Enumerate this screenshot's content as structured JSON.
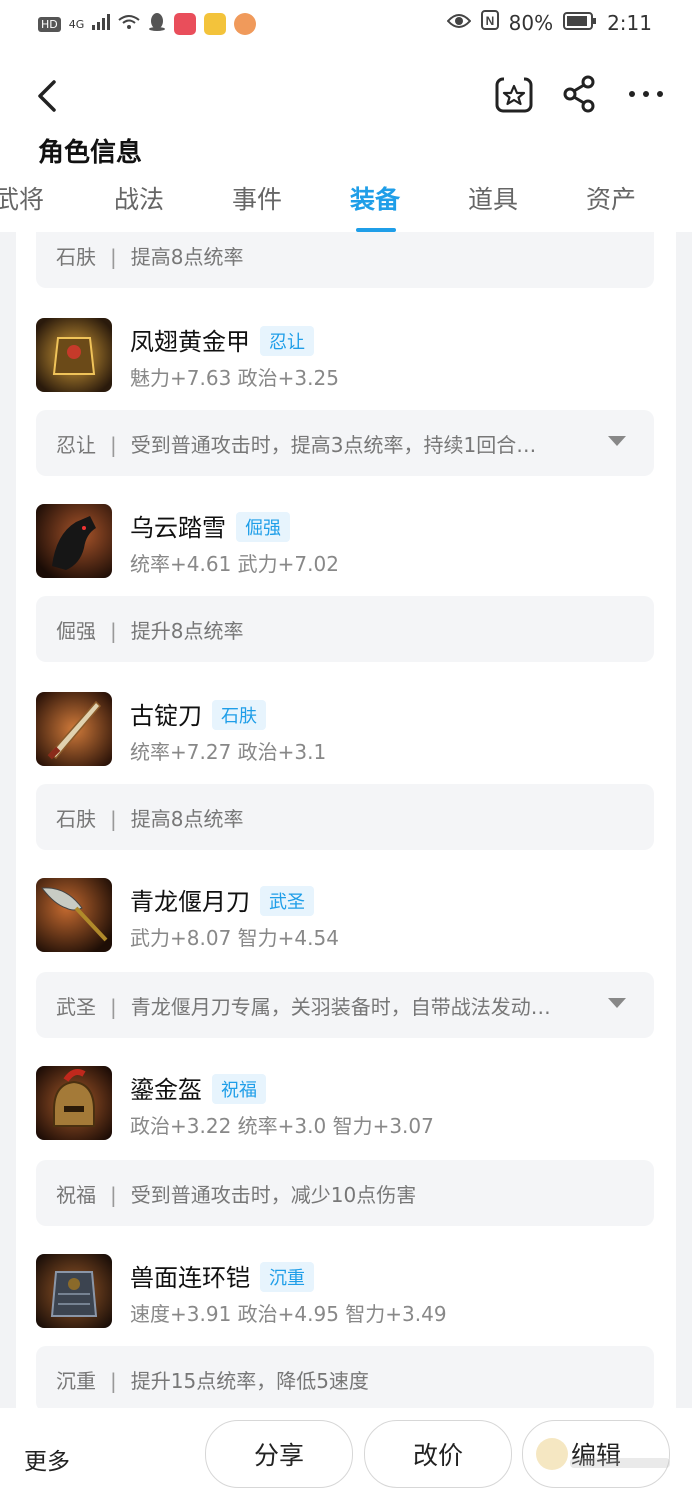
{
  "status_bar": {
    "network": "4G",
    "battery": "80%",
    "time": "2:11"
  },
  "header": {
    "title": "角色信息",
    "tabs": [
      {
        "label": "武将"
      },
      {
        "label": "战法"
      },
      {
        "label": "事件"
      },
      {
        "label": "装备",
        "active": true
      },
      {
        "label": "道具"
      },
      {
        "label": "资产"
      }
    ],
    "icons": [
      "back-icon",
      "favorite-star-icon",
      "share-icon",
      "more-icon"
    ]
  },
  "equipment": {
    "partial_top": {
      "tag": "石肤",
      "desc": "提高8点统率"
    },
    "items": [
      {
        "name": "凤翅黄金甲",
        "tag": "忍让",
        "stats": "魅力+7.63 政治+3.25",
        "desc": "受到普通攻击时，提高3点统率，持续1回合…",
        "expandable": true
      },
      {
        "name": "乌云踏雪",
        "tag": "倔强",
        "stats": "统率+4.61 武力+7.02",
        "desc": "提升8点统率",
        "expandable": false
      },
      {
        "name": "古锭刀",
        "tag": "石肤",
        "stats": "统率+7.27 政治+3.1",
        "desc": "提高8点统率",
        "expandable": false
      },
      {
        "name": "青龙偃月刀",
        "tag": "武圣",
        "stats": "武力+8.07 智力+4.54",
        "desc": "青龙偃月刀专属，关羽装备时，自带战法发动…",
        "expandable": true
      },
      {
        "name": "鎏金盔",
        "tag": "祝福",
        "stats": "政治+3.22 统率+3.0 智力+3.07",
        "desc": "受到普通攻击时，减少10点伤害",
        "expandable": false
      },
      {
        "name": "兽面连环铠",
        "tag": "沉重",
        "stats": "速度+3.91 政治+4.95 智力+3.49",
        "desc": "提升15点统率，降低5速度",
        "expandable": false
      }
    ]
  },
  "bottom_bar": {
    "more": "更多",
    "share": "分享",
    "reprice": "改价",
    "edit": "编辑"
  },
  "colors": {
    "accent": "#1f9ee8",
    "background": "#f2f3f5",
    "card": "#ffffff",
    "desc_bg": "#f4f5f7"
  }
}
